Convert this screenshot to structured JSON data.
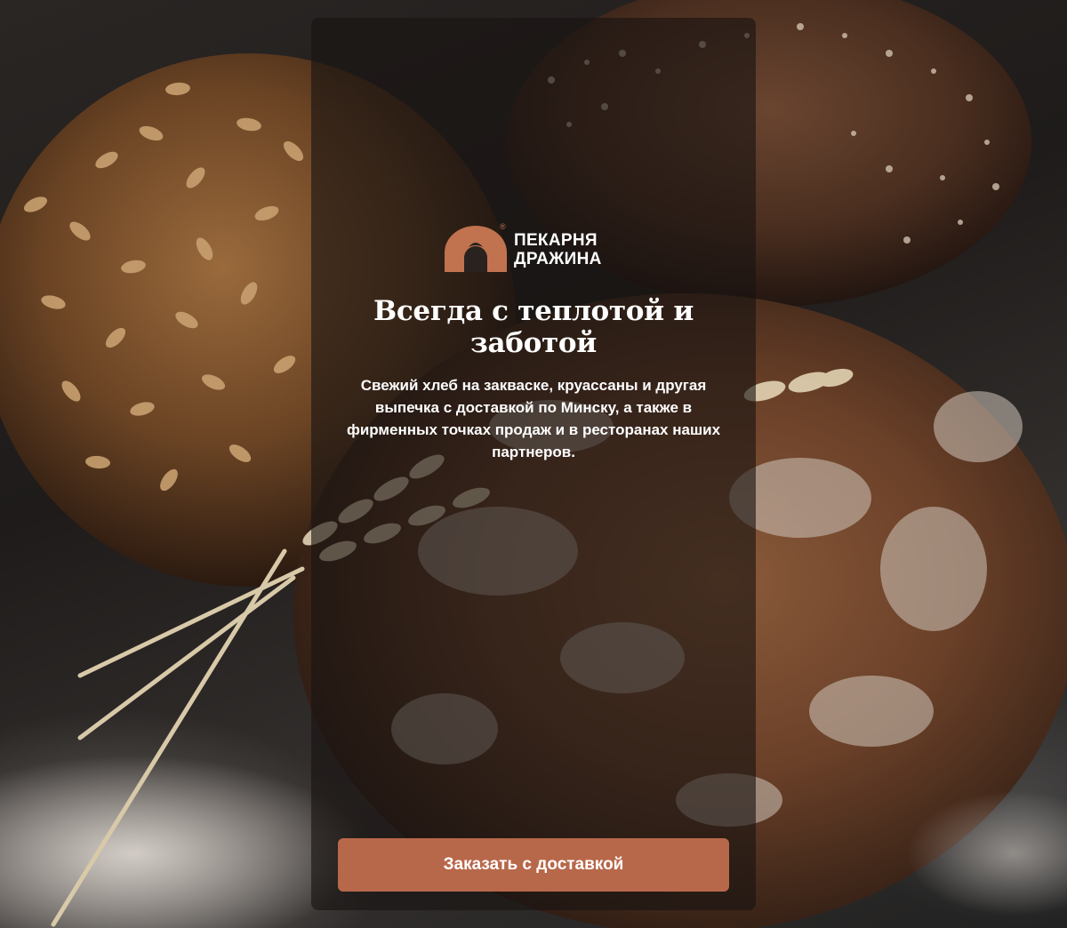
{
  "brand": {
    "name_line1": "ПЕКАРНЯ",
    "name_line2": "ДРАЖИНА",
    "registered_mark": "®",
    "color": "#c0734e"
  },
  "hero": {
    "headline": "Всегда с теплотой и заботой",
    "description": "Свежий хлеб на закваске, круассаны и другая выпечка с доставкой по Минску, а также в фирменных точках продаж и в ресторанах наших партнеров.",
    "cta_label": "Заказать с доставкой",
    "cta_color": "#b8684a",
    "background": "bread-loaves-photo"
  }
}
